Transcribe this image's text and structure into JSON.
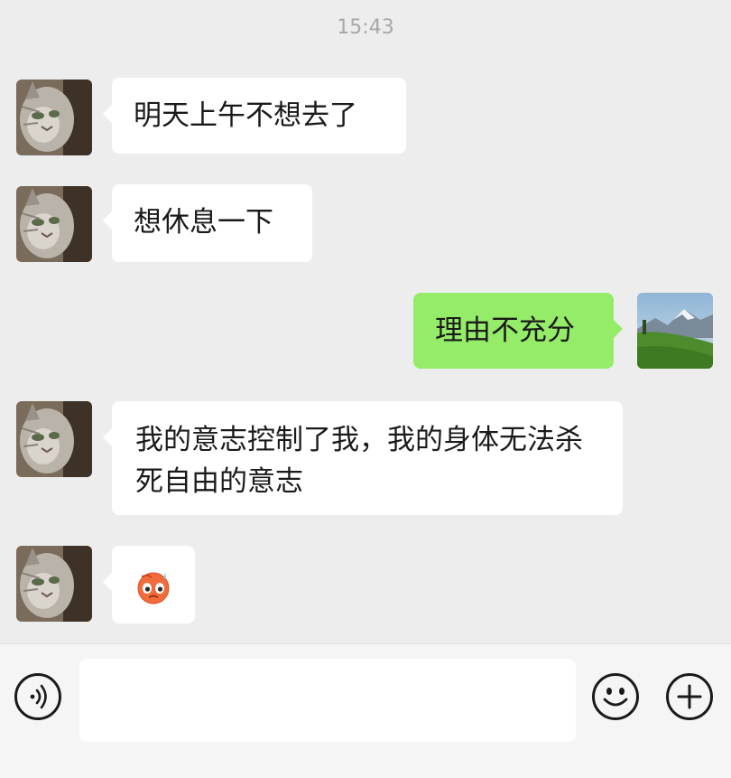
{
  "chat": {
    "timestamp": "15:43",
    "messages": [
      {
        "sender": "other",
        "text": "明天上午不想去了"
      },
      {
        "sender": "other",
        "text": "想休息一下"
      },
      {
        "sender": "self",
        "text": "理由不充分"
      },
      {
        "sender": "other",
        "text": "我的意志控制了我，我的身体无法杀死自由的意志"
      },
      {
        "sender": "other",
        "emoji": "sweating-face-sticker"
      }
    ]
  },
  "input_bar": {
    "placeholder": "",
    "icons": [
      "voice-icon",
      "emoji-icon",
      "plus-icon"
    ]
  },
  "colors": {
    "background": "#ededed",
    "self_bubble": "#95ec69",
    "other_bubble": "#ffffff",
    "timestamp": "#a8a8a8"
  }
}
